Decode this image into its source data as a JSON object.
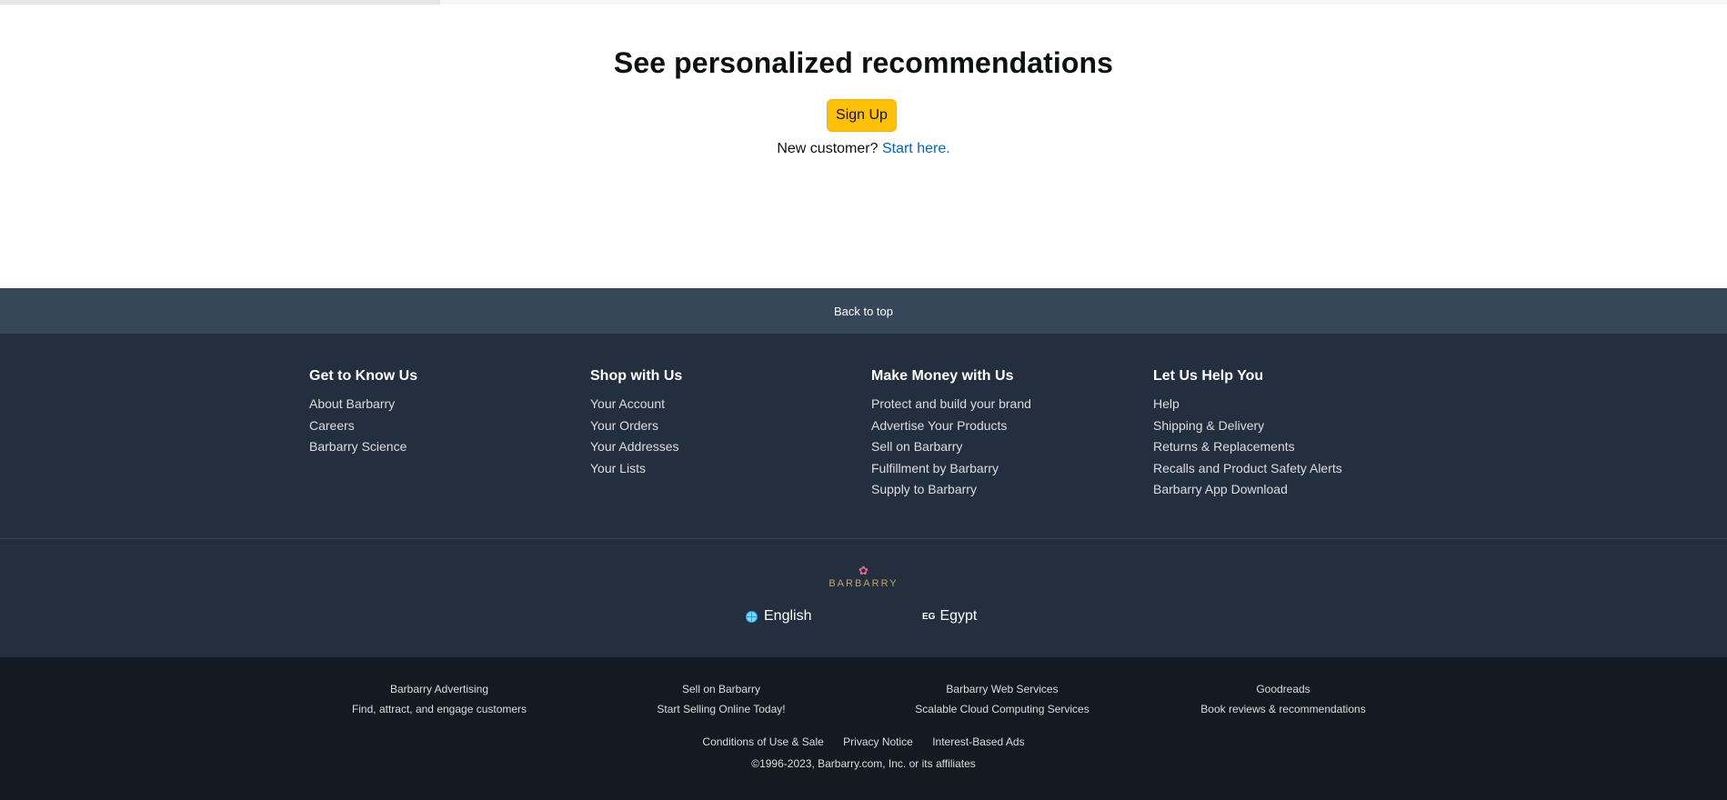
{
  "progress": {
    "fraction": 0.255
  },
  "recommendations": {
    "title": "See personalized recommendations",
    "signup_label": "Sign Up",
    "new_customer_text": "New customer?",
    "start_here_label": "Start here."
  },
  "back_to_top": "Back to top",
  "footer_columns": [
    {
      "title": "Get to Know Us",
      "links": [
        "About Barbarry",
        "Careers",
        "Barbarry Science"
      ]
    },
    {
      "title": "Shop with Us",
      "links": [
        "Your Account",
        "Your Orders",
        "Your Addresses",
        "Your Lists"
      ]
    },
    {
      "title": "Make Money with Us",
      "links": [
        "Protect and build your brand",
        "Advertise Your Products",
        "Sell on Barbarry",
        "Fulfillment by Barbarry",
        "Supply to Barbarry"
      ]
    },
    {
      "title": "Let Us Help You",
      "links": [
        "Help",
        "Shipping & Delivery",
        "Returns & Replacements",
        "Recalls and Product Safety Alerts",
        "Barbarry App Download"
      ]
    }
  ],
  "logo": {
    "text": "BARBARRY",
    "icon": "flower-icon"
  },
  "language": {
    "label": "English",
    "icon": "globe-icon"
  },
  "country": {
    "code": "EG",
    "label": "Egypt"
  },
  "services": [
    {
      "name": "Barbarry Advertising",
      "desc": "Find, attract, and engage customers"
    },
    {
      "name": "Sell on Barbarry",
      "desc": "Start Selling Online Today!"
    },
    {
      "name": "Barbarry Web Services",
      "desc": "Scalable Cloud Computing Services"
    },
    {
      "name": "Goodreads",
      "desc": "Book reviews & recommendations"
    }
  ],
  "legal_links": [
    "Conditions of Use & Sale",
    "Privacy Notice",
    "Interest-Based Ads"
  ],
  "copyright": "©1996-2023, Barbarry.com, Inc. or its affiliates",
  "colors": {
    "signup_button": "#ffc107",
    "back_to_top_bg": "#37475a",
    "footer_bg": "#232f3e",
    "footer_bottom_bg": "#131a22",
    "link": "#0066c0"
  }
}
